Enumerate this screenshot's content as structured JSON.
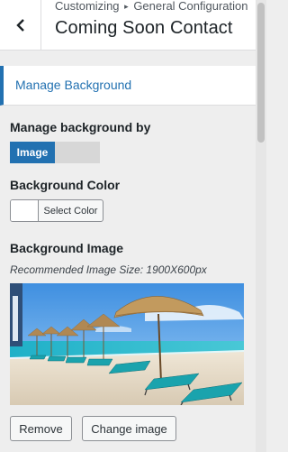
{
  "header": {
    "breadcrumb_prefix": "Customizing",
    "breadcrumb_arrow": "▸",
    "breadcrumb_section": "General Configuration",
    "title": "Coming Soon Contact",
    "back_icon": "chevron-left-icon"
  },
  "section": {
    "title": "Manage Background",
    "accent": "#2271b1"
  },
  "manage_by": {
    "label": "Manage background by",
    "options": [
      "Image",
      ""
    ],
    "selected": "Image"
  },
  "background_color": {
    "label": "Background Color",
    "button_label": "Select Color",
    "value": "#ffffff"
  },
  "background_image": {
    "label": "Background Image",
    "hint": "Recommended Image Size: 1900X600px",
    "remove_label": "Remove",
    "change_label": "Change image"
  }
}
